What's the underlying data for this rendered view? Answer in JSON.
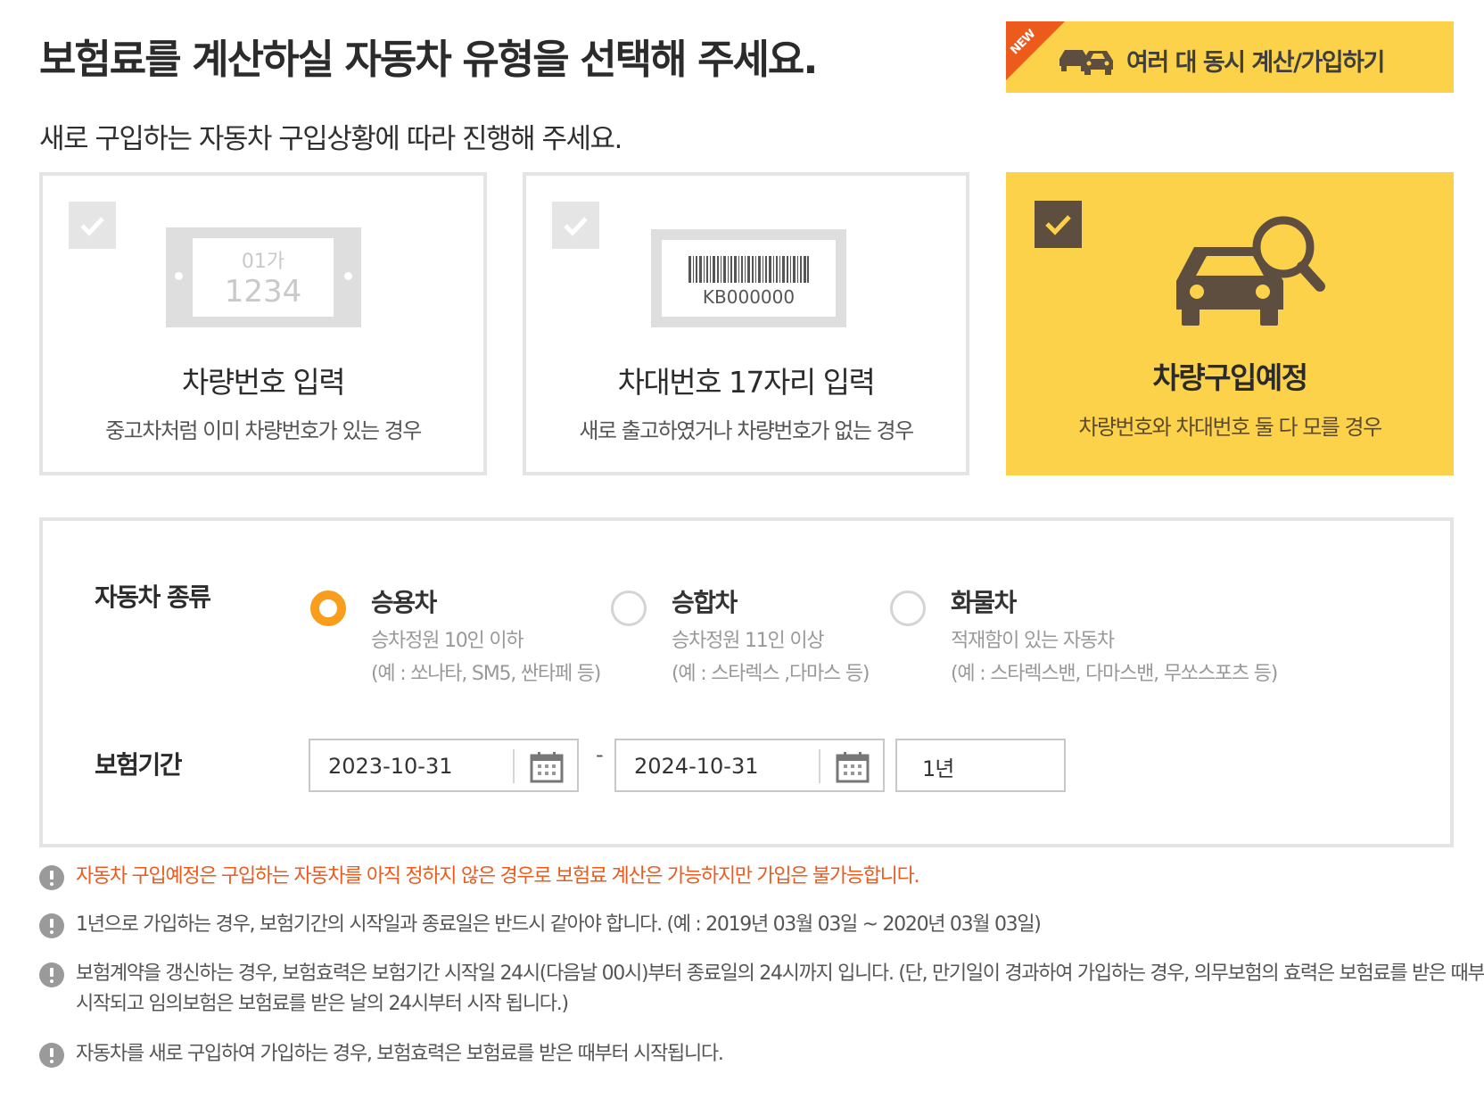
{
  "header": {
    "title": "보험료를 계산하실 자동차 유형을 선택해 주세요.",
    "multi_button": {
      "label": "여러 대 동시 계산/가입하기",
      "ribbon": "NEW"
    }
  },
  "subtitle": "새로 구입하는 자동차 구입상황에 따라 진행해 주세요.",
  "cards": [
    {
      "title": "차량번호 입력",
      "desc": "중고차처럼 이미 차량번호가 있는 경우",
      "plate_line1": "01가",
      "plate_line2": "1234",
      "selected": false
    },
    {
      "title": "차대번호 17자리 입력",
      "desc": "새로 출고하였거나 차량번호가 없는 경우",
      "vin_code": "KB000000",
      "selected": false
    },
    {
      "title": "차량구입예정",
      "desc": "차량번호와 차대번호 둘 다 모를 경우",
      "selected": true
    }
  ],
  "form": {
    "car_type_label": "자동차 종류",
    "car_types": [
      {
        "title": "승용차",
        "sub1": "승차정원 10인 이하",
        "sub2": "(예 : 쏘나타, SM5, 싼타페 등)",
        "checked": true
      },
      {
        "title": "승합차",
        "sub1": "승차정원 11인 이상",
        "sub2": "(예 : 스타렉스 ,다마스 등)",
        "checked": false
      },
      {
        "title": "화물차",
        "sub1": "적재함이 있는 자동차",
        "sub2": "(예 : 스타렉스밴, 다마스밴, 무쏘스포츠 등)",
        "checked": false
      }
    ],
    "period_label": "보험기간",
    "start_date": "2023-10-31",
    "end_date": "2024-10-31",
    "separator": "-",
    "period_value": "1년"
  },
  "notices": [
    {
      "text": "자동차 구입예정은 구입하는 자동차를 아직 정하지 않은 경우로 보험료 계산은 가능하지만 가입은 불가능합니다.",
      "warn": true
    },
    {
      "text": "1년으로 가입하는 경우, 보험기간의 시작일과 종료일은 반드시 같아야 합니다. (예 : 2019년 03월 03일 ~ 2020년 03월 03일)",
      "warn": false
    },
    {
      "text_line1": "보험계약을 갱신하는 경우, 보험효력은 보험기간 시작일 24시(다음날 00시)부터 종료일의 24시까지 입니다. (단, 만기일이 경과하여 가입하는 경우, 의무보험의 효력은 보험료를 받은 때부터",
      "text_line2": "시작되고 임의보험은 보험료를 받은 날의 24시부터 시작 됩니다.)",
      "warn": false
    },
    {
      "text": "자동차를 새로 구입하여 가입하는 경우, 보험효력은 보험료를 받은 때부터 시작됩니다.",
      "warn": false
    }
  ],
  "colors": {
    "accent": "#fdd24b",
    "ribbon": "#ec5a1c",
    "radio": "#f89d1c",
    "warning_text": "#ec5a1c",
    "check_dark": "#5e4e3f"
  },
  "icons": [
    "cars-icon",
    "check-icon",
    "license-plate-icon",
    "barcode-icon",
    "car-search-icon",
    "calendar-icon",
    "info-icon"
  ]
}
